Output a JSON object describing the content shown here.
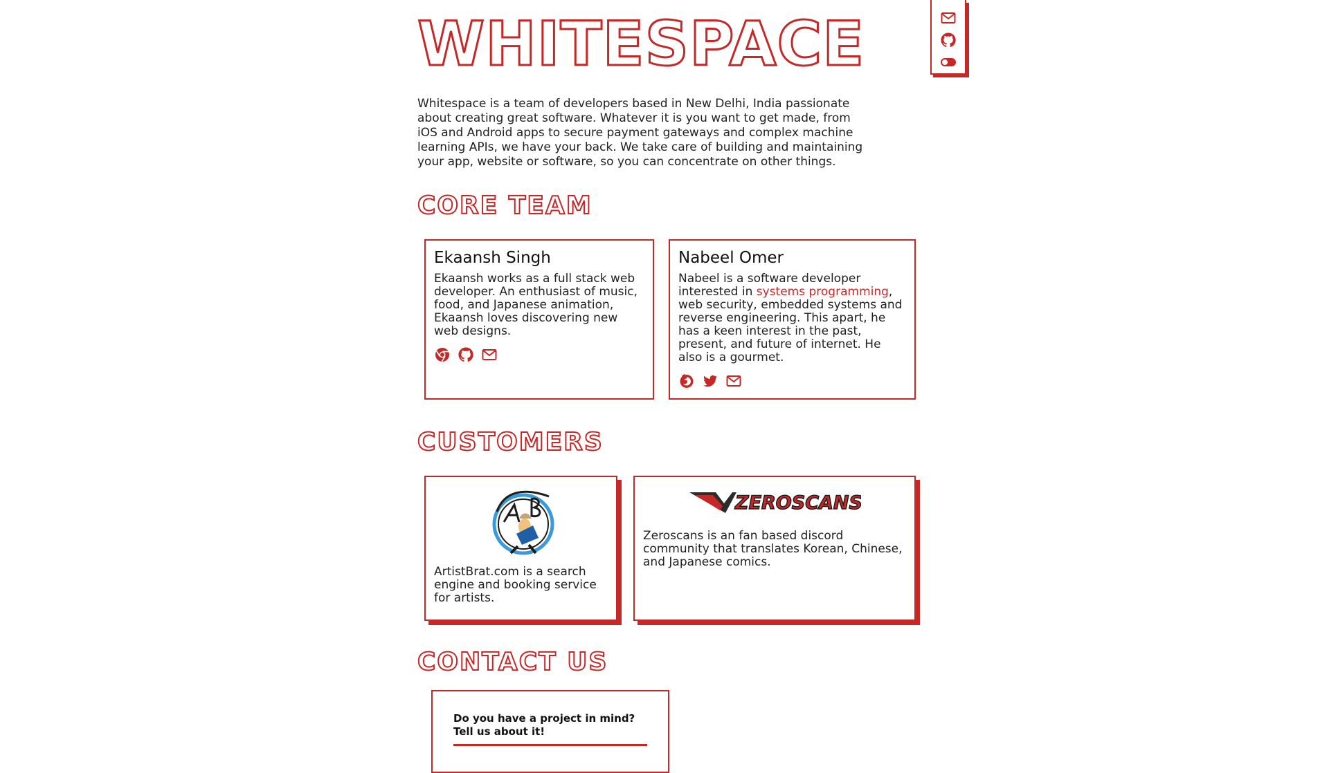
{
  "site": {
    "title": "WHITESPACE",
    "intro": "Whitespace is a team of developers based in New Delhi, India passionate about creating great software. Whatever it is you want to get made, from iOS and Android apps to secure payment gateways and complex machine learning APIs, we have your back. We take care of building and maintaining your app, website or software, so you can concentrate on other things."
  },
  "side_nav": {
    "icons": [
      "mail-icon",
      "github-icon",
      "toggle-icon"
    ]
  },
  "core_team": {
    "heading": "CORE TEAM",
    "members": [
      {
        "name": "Ekaansh Singh",
        "bio": "Ekaansh works as a full stack web developer. An enthusiast of music, food, and Japanese animation, Ekaansh loves discovering new web designs.",
        "icons": [
          "chrome-icon",
          "github-icon",
          "mail-icon"
        ]
      },
      {
        "name": "Nabeel Omer",
        "bio_before": "Nabeel is a software developer interested in ",
        "bio_link": "systems programming",
        "bio_after": ", web security, embedded systems and reverse engineering. This apart, he has a keen interest in the past, present, and future of internet. He also is a gourmet.",
        "icons": [
          "firefox-icon",
          "twitter-icon",
          "mail-icon"
        ]
      }
    ]
  },
  "customers": {
    "heading": "CUSTOMERS",
    "items": [
      {
        "logo": "artistbrat-logo",
        "description": "ArtistBrat.com is a search engine and booking service for artists."
      },
      {
        "logo": "zeroscans-logo",
        "logo_text": "ZEROSCANS",
        "description": "Zeroscans is an fan based discord community that translates Korean, Chinese, and Japanese comics."
      }
    ]
  },
  "contact": {
    "heading": "CONTACT US",
    "prompt": "Do you have a project in mind? Tell us about it!"
  },
  "colors": {
    "accent": "#c62828",
    "text": "#222222",
    "background": "#ffffff"
  }
}
